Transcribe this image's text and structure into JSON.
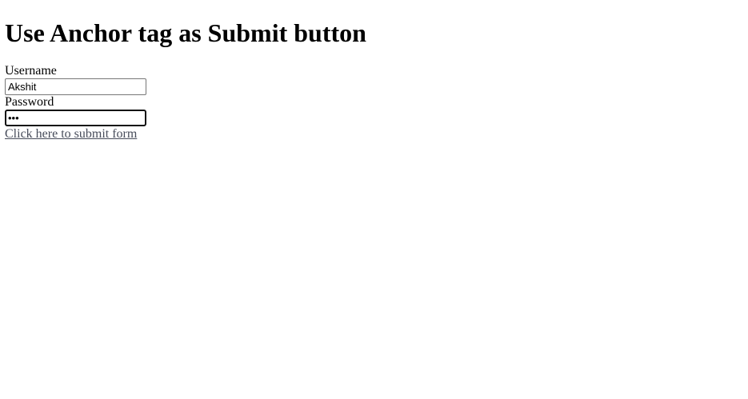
{
  "page": {
    "heading": "Use Anchor tag as Submit button"
  },
  "form": {
    "username_label": "Username",
    "username_value": "Akshit",
    "password_label": "Password",
    "password_value": "abc",
    "submit_link_text": "Click here to submit form"
  },
  "colors": {
    "link": "#474c5a",
    "focused_border": "#101010",
    "input_border": "#767676"
  }
}
